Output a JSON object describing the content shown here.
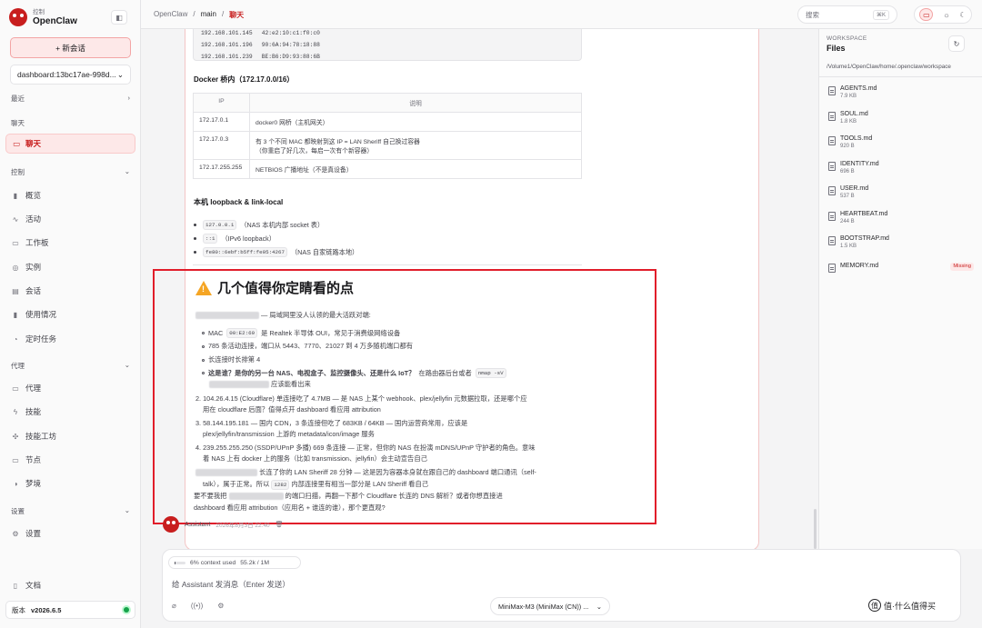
{
  "brand": {
    "small": "控制",
    "name": "OpenClaw"
  },
  "sidebar": {
    "new_chat": "+ 新会话",
    "session": "dashboard:13bc17ae-998d...",
    "recent": "最近",
    "chat_section": "聊天",
    "chat_item": "聊天",
    "control_section": "控制",
    "control_items": [
      {
        "label": "概览",
        "icon": "bar-chart-icon"
      },
      {
        "label": "活动",
        "icon": "activity-icon"
      },
      {
        "label": "工作板",
        "icon": "folder-icon"
      },
      {
        "label": "实例",
        "icon": "radio-icon"
      },
      {
        "label": "会话",
        "icon": "document-icon"
      },
      {
        "label": "使用情况",
        "icon": "bar-chart-icon"
      },
      {
        "label": "定时任务",
        "icon": "clock-icon"
      }
    ],
    "agent_section": "代理",
    "agent_items": [
      {
        "label": "代理",
        "icon": "folder-icon"
      },
      {
        "label": "技能",
        "icon": "zap-icon"
      },
      {
        "label": "技能工坊",
        "icon": "puzzle-icon"
      },
      {
        "label": "节点",
        "icon": "monitor-icon"
      },
      {
        "label": "梦境",
        "icon": "moon-icon"
      }
    ],
    "settings_section": "设置",
    "settings_item": "设置",
    "docs": "文档",
    "version_label": "版本",
    "version": "v2026.6.5"
  },
  "topbar": {
    "crumbs": [
      "OpenClaw",
      "/",
      "main",
      "/",
      "聊天"
    ],
    "search": "搜索",
    "shortcut": "⌘K"
  },
  "message": {
    "code_rows": [
      [
        "192.168.101.145",
        "42:e2:10:c1:f0:c0"
      ],
      [
        "192.168.101.196",
        "90:6A:94:78:18:88"
      ],
      [
        "192.168.101.239",
        "BE:B6:D9:93:88:6B"
      ]
    ],
    "docker_title": "Docker 桥内（172.17.0.0/16）",
    "table_headers": [
      "IP",
      "说明"
    ],
    "table_rows": [
      {
        "ip": "172.17.0.1",
        "desc": "docker0 网桥（主机网关）",
        "desc2": ""
      },
      {
        "ip": "172.17.0.3",
        "desc": "有 3 个不同 MAC 都映射到这 IP = LAN Sheriff 自己换过容器",
        "desc2": "（你重启了好几次，每启一次有个新容器）"
      },
      {
        "ip": "172.17.255.255",
        "desc": "NETBIOS 广播地址（不是真设备）",
        "desc2": ""
      }
    ],
    "loopback_title": "本机 loopback & link-local",
    "loopback": [
      {
        "code": "127.0.0.1",
        "text": "（NAS 本机内部 socket 表）"
      },
      {
        "code": "::1",
        "text": "（IPv6 loopback）"
      },
      {
        "code": "fe80::6ebf:b5ff:fe05:4267",
        "text": "（NAS 自家链路本地）"
      }
    ],
    "section_title": "几个值得你定睛看的点",
    "p1": "— 局域网里没人认领的最大活跃对端:",
    "b1": "MAC",
    "b1_code": "00:E2:69",
    "b1_text": "是 Realtek 半导体 OUI，常见于消费级网络设备",
    "b2": "785 条活动连接，端口从 5443、7770、21027 到 4 万多随机端口都有",
    "b3": "长连接时长排第 4",
    "b4": "这是谁？是你的另一台 NAS、电视盒子、监控摄像头、还是什么 IoT？",
    "b4_tail": "在路由器后台或者",
    "b4_code": "nmap -sV",
    "b4_line2": "应该能看出来",
    "p2a": "2. 104.26.4.15 (Cloudflare) 单连接吃了 4.7MB — 是 NAS 上某个 webhook、plex/jellyfin 元数据拉取，还是哪个应",
    "p2b": "用在 cloudflare 后面？值得点开 dashboard 看应用 attribution",
    "p3a": "3. 58.144.195.181 — 国内 CDN，3 条连接但吃了 683KB / 64KB — 国内运营商常用，应该是",
    "p3b": "plex/jellyfin/transmission 上游的 metadata/icon/image 服务",
    "p4a": "4. 239.255.255.250 (SSDP/UPnP 多播) 669 条连接 — 正常，但你的 NAS 在扮演 mDNS/UPnP 守护者的角色。意味",
    "p4b": "着 NAS 上有 docker 上的服务（比如 transmission、jellyfin）会主动宣告自己",
    "p5a": "长连了你的 LAN Sheriff 28 分钟 — 这是因为容器本身就在跟自己的 dashboard 端口通讯（self-",
    "p5b": "talk），属于正常。所以",
    "p5_code": "1282",
    "p5c": "内部连接里有相当一部分是 LAN Sheriff 看自己",
    "q1a": "要不要我把",
    "q1b": "的端口扫描，再翻一下那个 Cloudflare 长连的 DNS 解析？或者你想直接进",
    "q2": "dashboard 看应用 attribution（应用名 + 谁连的谁），那个更直观?",
    "author": "Assistant",
    "time": "2026年8月3日 22:40"
  },
  "composer": {
    "context": "6% context used",
    "tokens": "55.2k / 1M",
    "context_fraction": 0.06,
    "placeholder": "给 Assistant 发消息（Enter 发送）",
    "model": "MiniMax-M3 (MiniMax (CN)) ..."
  },
  "workspace": {
    "label": "WORKSPACE",
    "title": "Files",
    "path": "/Volume1/OpenClaw/home/.openclaw/workspace",
    "files": [
      {
        "name": "AGENTS.md",
        "size": "7.9 KB"
      },
      {
        "name": "SOUL.md",
        "size": "1.8 KB"
      },
      {
        "name": "TOOLS.md",
        "size": "920 B"
      },
      {
        "name": "IDENTITY.md",
        "size": "696 B"
      },
      {
        "name": "USER.md",
        "size": "537 B"
      },
      {
        "name": "HEARTBEAT.md",
        "size": "244 B"
      },
      {
        "name": "BOOTSTRAP.md",
        "size": "1.5 KB"
      },
      {
        "name": "MEMORY.md",
        "size": "",
        "badge": "Missing"
      }
    ]
  },
  "watermark": "值·什么值得买",
  "colors": {
    "accent": "#c81e1e",
    "highlight": "#e11d2a",
    "success": "#16a34a"
  }
}
